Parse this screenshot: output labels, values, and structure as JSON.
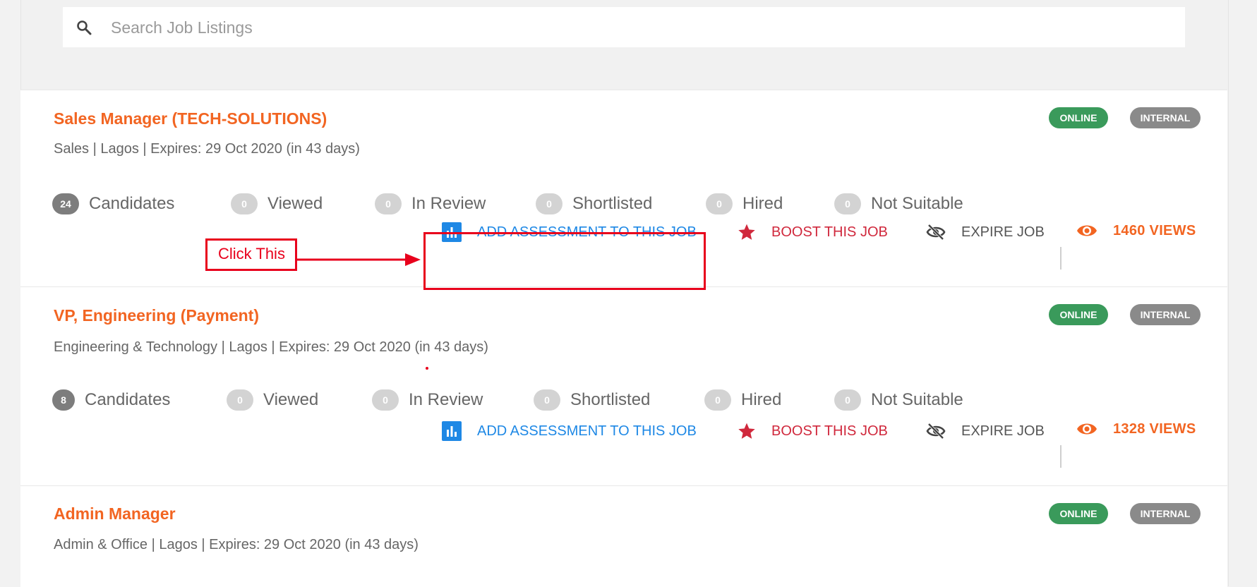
{
  "search": {
    "placeholder": "Search Job Listings"
  },
  "jobs": [
    {
      "title": "Sales Manager (TECH-SOLUTIONS)",
      "meta": "Sales | Lagos | Expires: 29 Oct 2020 (in 43 days)",
      "status": "ONLINE",
      "visibility": "INTERNAL",
      "stats": [
        {
          "count": "24",
          "label": "Candidates"
        },
        {
          "count": "0",
          "label": "Viewed"
        },
        {
          "count": "0",
          "label": "In Review"
        },
        {
          "count": "0",
          "label": "Shortlisted"
        },
        {
          "count": "0",
          "label": "Hired"
        },
        {
          "count": "0",
          "label": "Not Suitable"
        }
      ],
      "actions": {
        "assessment": "ADD ASSESSMENT TO THIS JOB",
        "boost": "BOOST THIS JOB",
        "expire": "EXPIRE JOB",
        "views": "1460 VIEWS"
      }
    },
    {
      "title": "VP, Engineering (Payment)",
      "meta": "Engineering & Technology | Lagos | Expires: 29 Oct 2020 (in 43 days)",
      "status": "ONLINE",
      "visibility": "INTERNAL",
      "stats": [
        {
          "count": "8",
          "label": "Candidates"
        },
        {
          "count": "0",
          "label": "Viewed"
        },
        {
          "count": "0",
          "label": "In Review"
        },
        {
          "count": "0",
          "label": "Shortlisted"
        },
        {
          "count": "0",
          "label": "Hired"
        },
        {
          "count": "0",
          "label": "Not Suitable"
        }
      ],
      "actions": {
        "assessment": "ADD ASSESSMENT TO THIS JOB",
        "boost": "BOOST THIS JOB",
        "expire": "EXPIRE JOB",
        "views": "1328 VIEWS"
      }
    },
    {
      "title": "Admin Manager",
      "meta": "Admin & Office | Lagos | Expires: 29 Oct 2020 (in 43 days)",
      "status": "ONLINE",
      "visibility": "INTERNAL"
    }
  ],
  "annotation": {
    "label": "Click This"
  },
  "colors": {
    "accent": "#f26522",
    "online": "#3a9a5b",
    "internal": "#8a8a8a",
    "link": "#1e88e5",
    "boost": "#d0283c",
    "annotation": "#e8001c"
  },
  "icons": [
    "search-icon",
    "bar-chart-icon",
    "star-icon",
    "eye-off-icon",
    "eye-icon"
  ]
}
